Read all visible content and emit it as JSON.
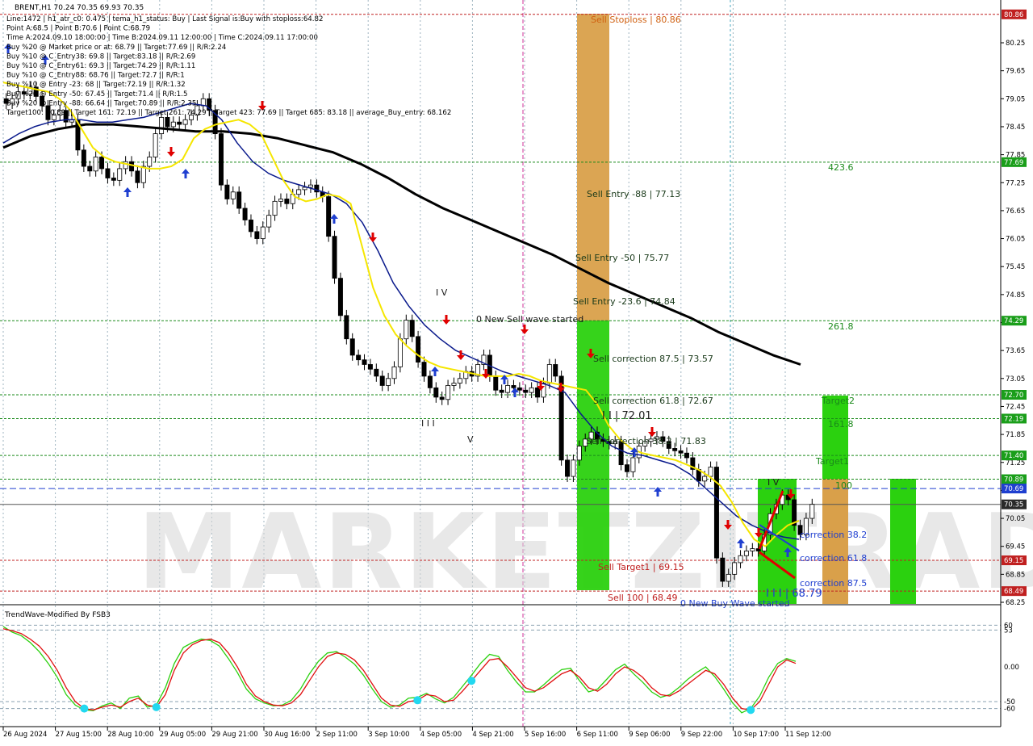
{
  "header": {
    "symbol_line": "BRENT,H1  70.24 70.35 69.93 70.35",
    "lines": [
      "Line:1472 | h1_atr_c0: 0.475 | tema_h1_status: Buy | Last Signal is:Buy with stoploss:64.82",
      "Point A:68.5 | Point B:70.6 | Point C:68.79",
      "Time A:2024.09.10 18:00:00 | Time B:2024.09.11 12:00:00 | Time C:2024.09.11 17:00:00",
      "Buy %20 @ Market price or at: 68.79 || Target:77.69 || R/R:2.24",
      "Buy %10 @ C_Entry38: 69.8 || Target:83.18 || R/R:2.69",
      "Buy %10 @ C_Entry61: 69.3 || Target:74.29 || R/R:1.11",
      "Buy %10 @ C_Entry88: 68.76 || Target:72.7 || R/R:1",
      "Buy %10 @ Entry -23: 68 || Target:72.19 || R/R:1.32",
      "Buy %20 @ Entry -50: 67.45 || Target:71.4 || R/R:1.5",
      "Buy %20 @ Entry -88: 66.64 || Target:70.89 || R/R:2.35",
      "Target100: 70.89 || Target 161: 72.19 || Target 261: 74.29 || Target 423: 77.69 || Target 685: 83.18 || average_Buy_entry: 68.162"
    ]
  },
  "colors": {
    "yellow_ma": "#f5e600",
    "blue_ma": "#0a1a8c",
    "black_ma": "#000000",
    "sell_orange": "#d9a04a",
    "buy_green": "#2bd10f",
    "osc_red": "#e01010",
    "osc_green": "#2bd10f",
    "osc_dot": "#22d8f0",
    "price_label_dark": "#2a2a2a",
    "price_label_green": "#1a9e1a",
    "price_label_red": "#c02020",
    "price_label_blue": "#1f3fd0"
  },
  "watermark": "MARKETZITRADE",
  "chart_data": {
    "type": "line",
    "title": "BRENT,H1",
    "price_axis": [
      "80.25",
      "79.65",
      "79.05",
      "78.45",
      "77.85",
      "77.25",
      "76.65",
      "76.05",
      "75.45",
      "74.85",
      "74.25",
      "73.65",
      "73.05",
      "72.45",
      "71.85",
      "71.25",
      "70.65",
      "70.05",
      "69.45",
      "68.85",
      "68.25"
    ],
    "ylim": [
      68.25,
      80.85
    ],
    "time_axis": [
      "26 Aug 2024",
      "27 Aug 15:00",
      "28 Aug 10:00",
      "29 Aug 05:00",
      "29 Aug 21:00",
      "30 Aug 16:00",
      "2 Sep 11:00",
      "3 Sep 10:00",
      "4 Sep 05:00",
      "4 Sep 21:00",
      "5 Sep 16:00",
      "6 Sep 11:00",
      "9 Sep 06:00",
      "9 Sep 22:00",
      "10 Sep 17:00",
      "11 Sep 12:00"
    ],
    "price_tags": [
      {
        "label": "80.86",
        "value": 80.86,
        "kind": "red"
      },
      {
        "label": "77.69",
        "value": 77.69,
        "kind": "green"
      },
      {
        "label": "74.29",
        "value": 74.29,
        "kind": "green"
      },
      {
        "label": "72.70",
        "value": 72.7,
        "kind": "green"
      },
      {
        "label": "72.19",
        "value": 72.19,
        "kind": "green"
      },
      {
        "label": "71.40",
        "value": 71.4,
        "kind": "green"
      },
      {
        "label": "70.89",
        "value": 70.89,
        "kind": "green"
      },
      {
        "label": "70.69",
        "value": 70.69,
        "kind": "blue"
      },
      {
        "label": "70.35",
        "value": 70.35,
        "kind": "dark"
      },
      {
        "label": "69.15",
        "value": 69.15,
        "kind": "red"
      },
      {
        "label": "68.49",
        "value": 68.49,
        "kind": "red"
      }
    ],
    "horizontal_levels": [
      {
        "value": 80.86,
        "color": "#c02020",
        "dash": true
      },
      {
        "value": 77.69,
        "color": "#1a8a1a",
        "dash": true
      },
      {
        "value": 74.29,
        "color": "#1a8a1a",
        "dash": true
      },
      {
        "value": 72.7,
        "color": "#1a8a1a",
        "dash": true
      },
      {
        "value": 72.19,
        "color": "#1a8a1a",
        "dash": true
      },
      {
        "value": 71.4,
        "color": "#1a8a1a",
        "dash": true
      },
      {
        "value": 70.89,
        "color": "#1a8a1a",
        "dash": true
      },
      {
        "value": 70.69,
        "color": "#1f3fd0",
        "dash": true
      },
      {
        "value": 70.35,
        "color": "#555555",
        "dash": false
      },
      {
        "value": 69.15,
        "color": "#c02020",
        "dash": true
      },
      {
        "value": 68.49,
        "color": "#c02020",
        "dash": true
      }
    ],
    "annotations": [
      {
        "text": "Sell Stoploss | 80.86",
        "value": 80.86,
        "color": "#d06010"
      },
      {
        "text": "423.6",
        "value": 77.69,
        "color": "#1a8a1a"
      },
      {
        "text": "Sell Entry -88 | 77.13",
        "value": 77.13,
        "color": "#1a3a1a"
      },
      {
        "text": "Sell Entry -50 | 75.77",
        "value": 75.77,
        "color": "#1a3a1a"
      },
      {
        "text": "Sell Entry -23.6 | 74.84",
        "value": 74.84,
        "color": "#1a3a1a"
      },
      {
        "text": "0 New Sell wave started",
        "value": 74.29,
        "color": "#1a1a1a"
      },
      {
        "text": "261.8",
        "value": 74.29,
        "color": "#1a8a1a"
      },
      {
        "text": "Sell correction 87.5 | 73.57",
        "value": 73.57,
        "color": "#1a3a1a"
      },
      {
        "text": "Target2",
        "value": 72.7,
        "color": "#1a8a1a"
      },
      {
        "text": "Sell correction 61.8 | 72.67",
        "value": 72.67,
        "color": "#1a3a1a"
      },
      {
        "text": "I I | 72.01",
        "value": 72.01,
        "color": "#1a1a1a"
      },
      {
        "text": "161.8",
        "value": 72.19,
        "color": "#1a8a1a"
      },
      {
        "text": "Sell correction 38.2 | 71.83",
        "value": 71.83,
        "color": "#1a3a1a"
      },
      {
        "text": "Target1",
        "value": 71.4,
        "color": "#1a8a1a"
      },
      {
        "text": "100",
        "value": 70.89,
        "color": "#1a8a1a"
      },
      {
        "text": "I V",
        "value": 70.89,
        "color": "#1a1a1a"
      },
      {
        "text": "correction 38.2",
        "value": 69.93,
        "color": "#1f3fd0"
      },
      {
        "text": "correction 61.8",
        "value": 69.35,
        "color": "#1f3fd0"
      },
      {
        "text": "Sell Target1 | 69.15",
        "value": 69.15,
        "color": "#c02020"
      },
      {
        "text": "correction 87.5",
        "value": 68.78,
        "color": "#1f3fd0"
      },
      {
        "text": "I I I | 68.79",
        "value": 68.6,
        "color": "#1f3fd0"
      },
      {
        "text": "Sell 100 | 68.49",
        "value": 68.4,
        "color": "#c02020"
      },
      {
        "text": "0 New Buy Wave started",
        "value": 68.15,
        "color": "#1f3fd0"
      },
      {
        "text": "I V",
        "value": 74.7,
        "color": "#1a1a1a"
      },
      {
        "text": "I I I",
        "value": 72.3,
        "color": "#1a1a1a"
      },
      {
        "text": "V",
        "value": 71.8,
        "color": "#1a1a1a"
      }
    ],
    "series": [
      {
        "kind": "close",
        "values": [
          78.95,
          79.05,
          79.2,
          79.15,
          79.3,
          79.1,
          78.9,
          78.6,
          78.7,
          78.8,
          78.55,
          78.6,
          77.95,
          77.6,
          77.5,
          77.8,
          77.55,
          77.35,
          77.3,
          77.55,
          77.7,
          77.5,
          77.25,
          77.6,
          77.8,
          78.3,
          78.65,
          78.45,
          78.55,
          78.5,
          78.6,
          78.7,
          78.9,
          79.05,
          78.8,
          78.3,
          77.2,
          76.9,
          77.05,
          76.7,
          76.45,
          76.2,
          76.05,
          76.3,
          76.55,
          76.85,
          76.9,
          76.8,
          77.0,
          77.1,
          77.15,
          77.2,
          77.05,
          76.95,
          76.1,
          75.2,
          74.4,
          73.9,
          73.55,
          73.45,
          73.35,
          73.25,
          73.1,
          72.9,
          73.05,
          73.3,
          73.9,
          74.3,
          73.95,
          73.4,
          73.1,
          72.85,
          72.65,
          72.6,
          72.9,
          72.95,
          73.05,
          73.2,
          73.1,
          73.35,
          73.55,
          73.1,
          72.8,
          72.75,
          72.9,
          72.85,
          72.8,
          72.75,
          72.85,
          72.65,
          72.95,
          73.35,
          73.1,
          71.3,
          70.95,
          71.3,
          71.6,
          71.75,
          71.9,
          71.75,
          71.7,
          71.65,
          71.7,
          71.2,
          71.05,
          71.35,
          71.6,
          71.7,
          71.75,
          71.8,
          71.7,
          71.55,
          71.5,
          71.45,
          71.35,
          71.1,
          70.85,
          70.95,
          71.15,
          69.2,
          68.7,
          68.85,
          69.1,
          69.25,
          69.35,
          69.4,
          69.35,
          69.7,
          70.15,
          70.35,
          70.55,
          70.45,
          69.9,
          69.7,
          70.05,
          70.35
        ]
      },
      {
        "kind": "yellow_ma",
        "values": [
          79.4,
          79.35,
          79.3,
          79.25,
          79.2,
          79.05,
          78.8,
          78.4,
          78.0,
          77.8,
          77.7,
          77.65,
          77.6,
          77.55,
          77.55,
          77.6,
          77.75,
          78.2,
          78.4,
          78.5,
          78.55,
          78.6,
          78.5,
          78.3,
          77.8,
          77.3,
          76.95,
          76.85,
          76.9,
          77.0,
          76.95,
          76.8,
          75.9,
          75.0,
          74.4,
          74.0,
          73.75,
          73.55,
          73.4,
          73.3,
          73.25,
          73.2,
          73.15,
          73.1,
          73.1,
          73.1,
          73.15,
          73.1,
          73.0,
          72.95,
          72.9,
          72.85,
          72.8,
          72.5,
          72.05,
          71.75,
          71.55,
          71.45,
          71.4,
          71.35,
          71.3,
          71.2,
          71.1,
          70.95,
          70.75,
          70.4,
          69.95,
          69.6,
          69.45,
          69.7,
          69.9,
          70.0
        ]
      },
      {
        "kind": "blue_ma",
        "values": [
          78.1,
          78.3,
          78.45,
          78.55,
          78.6,
          78.6,
          78.55,
          78.55,
          78.6,
          78.65,
          78.75,
          78.85,
          78.95,
          78.9,
          78.6,
          78.1,
          77.7,
          77.45,
          77.3,
          77.2,
          77.1,
          77.0,
          76.8,
          76.4,
          75.8,
          75.1,
          74.6,
          74.2,
          73.9,
          73.65,
          73.5,
          73.35,
          73.2,
          73.1,
          73.0,
          72.9,
          72.75,
          72.3,
          71.9,
          71.6,
          71.45,
          71.4,
          71.3,
          71.2,
          71.0,
          70.7,
          70.4,
          70.1,
          69.9,
          69.75,
          69.65,
          69.6
        ]
      },
      {
        "kind": "black_ma",
        "values": [
          78.0,
          78.25,
          78.4,
          78.5,
          78.5,
          78.45,
          78.4,
          78.35,
          78.35,
          78.3,
          78.2,
          78.05,
          77.9,
          77.65,
          77.35,
          77.0,
          76.7,
          76.45,
          76.2,
          75.95,
          75.7,
          75.4,
          75.1,
          74.85,
          74.6,
          74.35,
          74.05,
          73.8,
          73.55,
          73.35
        ]
      }
    ],
    "indicator": {
      "title": "TrendWave-Modified By FSB3",
      "axis": [
        "60",
        "53",
        "0.00",
        "-50",
        "-60"
      ],
      "ylim": [
        -75,
        70
      ],
      "levels": [
        60,
        53,
        -50,
        -60
      ],
      "red": [
        55,
        52,
        48,
        40,
        30,
        15,
        -5,
        -30,
        -50,
        -60,
        -62,
        -58,
        -55,
        -58,
        -50,
        -45,
        -55,
        -58,
        -40,
        -5,
        20,
        32,
        38,
        40,
        35,
        20,
        0,
        -25,
        -42,
        -50,
        -55,
        -56,
        -52,
        -40,
        -20,
        0,
        15,
        20,
        18,
        10,
        -5,
        -25,
        -45,
        -55,
        -57,
        -50,
        -48,
        -40,
        -42,
        -50,
        -48,
        -35,
        -20,
        -5,
        10,
        12,
        0,
        -15,
        -30,
        -35,
        -30,
        -20,
        -10,
        -5,
        -15,
        -30,
        -35,
        -25,
        -10,
        0,
        -5,
        -15,
        -30,
        -40,
        -42,
        -35,
        -25,
        -15,
        -5,
        -10,
        -25,
        -45,
        -60,
        -62,
        -50,
        -25,
        0,
        10,
        5
      ],
      "green": [
        58,
        50,
        45,
        35,
        22,
        5,
        -15,
        -40,
        -55,
        -62,
        -63,
        -56,
        -52,
        -60,
        -45,
        -42,
        -58,
        -55,
        -30,
        5,
        28,
        35,
        40,
        38,
        30,
        12,
        -8,
        -32,
        -46,
        -52,
        -56,
        -55,
        -48,
        -32,
        -10,
        8,
        20,
        22,
        14,
        4,
        -12,
        -32,
        -50,
        -58,
        -55,
        -45,
        -44,
        -38,
        -46,
        -52,
        -44,
        -28,
        -12,
        5,
        18,
        15,
        -5,
        -22,
        -36,
        -36,
        -26,
        -14,
        -4,
        -2,
        -20,
        -36,
        -32,
        -18,
        -4,
        4,
        -10,
        -22,
        -36,
        -44,
        -40,
        -30,
        -18,
        -8,
        0,
        -14,
        -32,
        -52,
        -66,
        -60,
        -42,
        -15,
        5,
        12,
        8
      ],
      "dots_index": [
        9,
        17,
        46,
        52,
        83
      ]
    }
  }
}
